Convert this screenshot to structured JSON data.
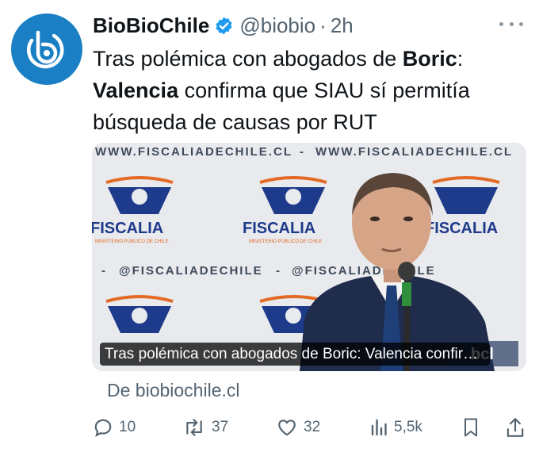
{
  "post": {
    "author_name": "BioBioChile",
    "handle": "@biobio",
    "separator": "·",
    "time": "2h",
    "text_parts": {
      "p1": "Tras polémica con abogados de ",
      "b1": "Boric",
      "p2": ": ",
      "b2": "Valencia",
      "p3": " confirma que SIAU sí permitía búsqueda de causas por RUT"
    }
  },
  "card": {
    "caption": "Tras polémica con abogados de Boric: Valencia confirma que SIAU sí permitía búsqueda de causas por RUT",
    "banner_url_text": "WWW.FISCALIADECHILE.CL",
    "banner_separator": "-",
    "banner_handle": "@FISCALIADECHILE",
    "banner_logo_word": "FISCALIA",
    "banner_logo_sub": "MINISTERIO PÚBLICO DE CHILE",
    "watermark": "bcl"
  },
  "source_link": "De biobiochile.cl",
  "actions": {
    "reply_count": "10",
    "repost_count": "37",
    "like_count": "32",
    "view_count": "5,5k"
  },
  "colors": {
    "avatar_bg": "#1a7fc4",
    "verified_blue": "#1d9bf0",
    "logo_navy": "#1e3a8a",
    "logo_orange": "#e36a25",
    "secondary_text": "#536471"
  },
  "icons": {
    "avatar": "biobio-logo-icon",
    "verified": "verified-badge-icon",
    "more": "more-options-icon",
    "reply": "reply-icon",
    "repost": "repost-icon",
    "like": "heart-icon",
    "views": "views-icon",
    "bookmark": "bookmark-icon",
    "share": "share-icon"
  }
}
